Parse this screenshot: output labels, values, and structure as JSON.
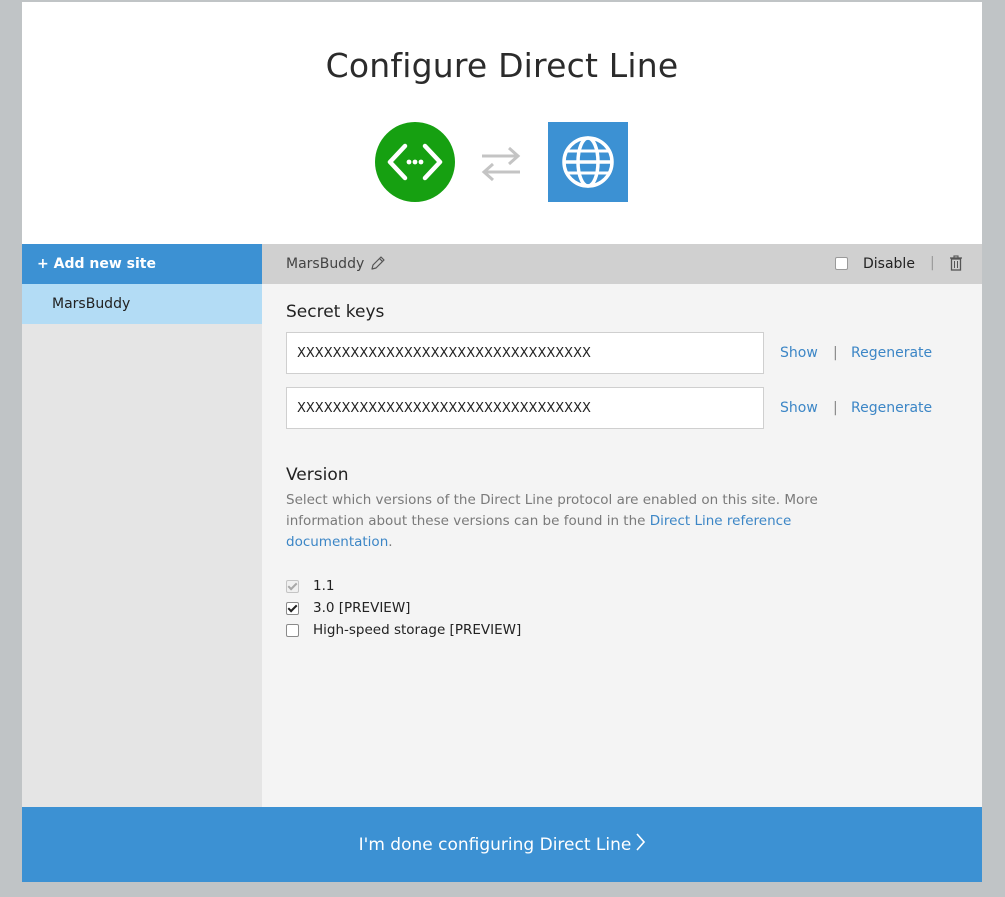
{
  "dialog": {
    "title": "Configure Direct Line",
    "icons": {
      "bot": "direct-line-bot-icon",
      "arrows": "swap-arrows-icon",
      "web": "globe-icon"
    },
    "colors": {
      "accent": "#3c91d3",
      "bot_green": "#16a011",
      "link": "#3c86c6",
      "selected": "#b3dcf5"
    }
  },
  "sidebar": {
    "add_label": "+ Add new site",
    "items": [
      {
        "label": "MarsBuddy",
        "selected": true
      }
    ]
  },
  "site_bar": {
    "name": "MarsBuddy",
    "disable_label": "Disable",
    "separator": "|",
    "disabled": false
  },
  "secret_keys": {
    "title": "Secret keys",
    "keys": [
      {
        "value": "XXXXXXXXXXXXXXXXXXXXXXXXXXXXXXXXX",
        "show_label": "Show",
        "regenerate_label": "Regenerate"
      },
      {
        "value": "XXXXXXXXXXXXXXXXXXXXXXXXXXXXXXXXX",
        "show_label": "Show",
        "regenerate_label": "Regenerate"
      }
    ],
    "separator": "|"
  },
  "version": {
    "title": "Version",
    "description_pre": "Select which versions of the Direct Line protocol are enabled on this site. More information about these versions can be found in the ",
    "link_text": "Direct Line reference documentation",
    "description_post": ".",
    "options": [
      {
        "label": "1.1",
        "checked": true,
        "disabled": true
      },
      {
        "label": "3.0 [PREVIEW]",
        "checked": true,
        "disabled": false
      },
      {
        "label": "High-speed storage [PREVIEW]",
        "checked": false,
        "disabled": false
      }
    ]
  },
  "footer": {
    "label": "I'm done configuring Direct Line"
  }
}
